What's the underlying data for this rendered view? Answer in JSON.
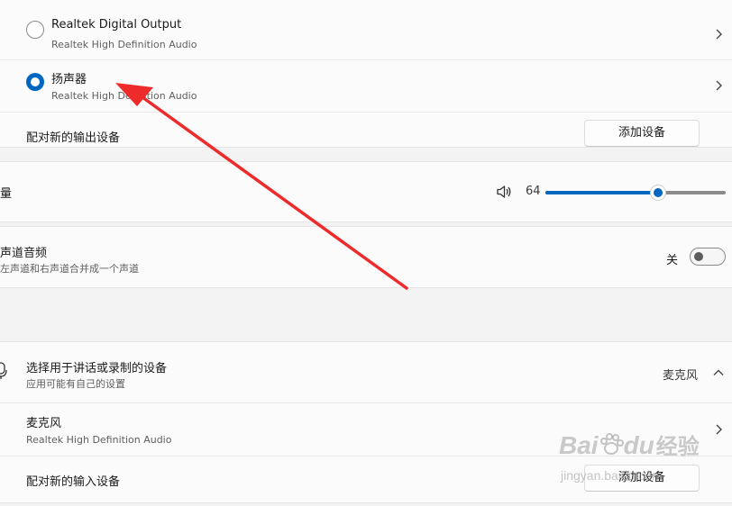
{
  "output_devices": [
    {
      "name": "Realtek Digital Output",
      "detail": "Realtek High Definition Audio",
      "selected": false
    },
    {
      "name": "扬声器",
      "detail": "Realtek High Definition Audio",
      "selected": true
    }
  ],
  "pair_output": {
    "label": "配对新的输出设备",
    "button": "添加设备"
  },
  "volume": {
    "label": "量",
    "value": "64",
    "level": 64
  },
  "mono": {
    "title": "声道音频",
    "desc": "左声道和右声道合并成一个声道",
    "state_label": "关"
  },
  "input": {
    "header_title": "选择用于讲话或录制的设备",
    "header_sub": "应用可能有自己的设置",
    "selected_label": "麦克风",
    "devices": [
      {
        "name": "麦克风",
        "detail": "Realtek High Definition Audio"
      }
    ],
    "pair_label": "配对新的输入设备",
    "pair_button": "添加设备"
  },
  "watermark": {
    "brand_a": "Bai",
    "brand_b": "du",
    "suffix": "经验",
    "url": "jingyan.baidu.com"
  },
  "colors": {
    "accent": "#0067c0",
    "annotation_arrow": "#ee2b2b"
  },
  "icons": [
    "chevron-right-icon",
    "speaker-icon",
    "microphone-icon",
    "chevron-up-icon",
    "baidu-paw-icon"
  ]
}
